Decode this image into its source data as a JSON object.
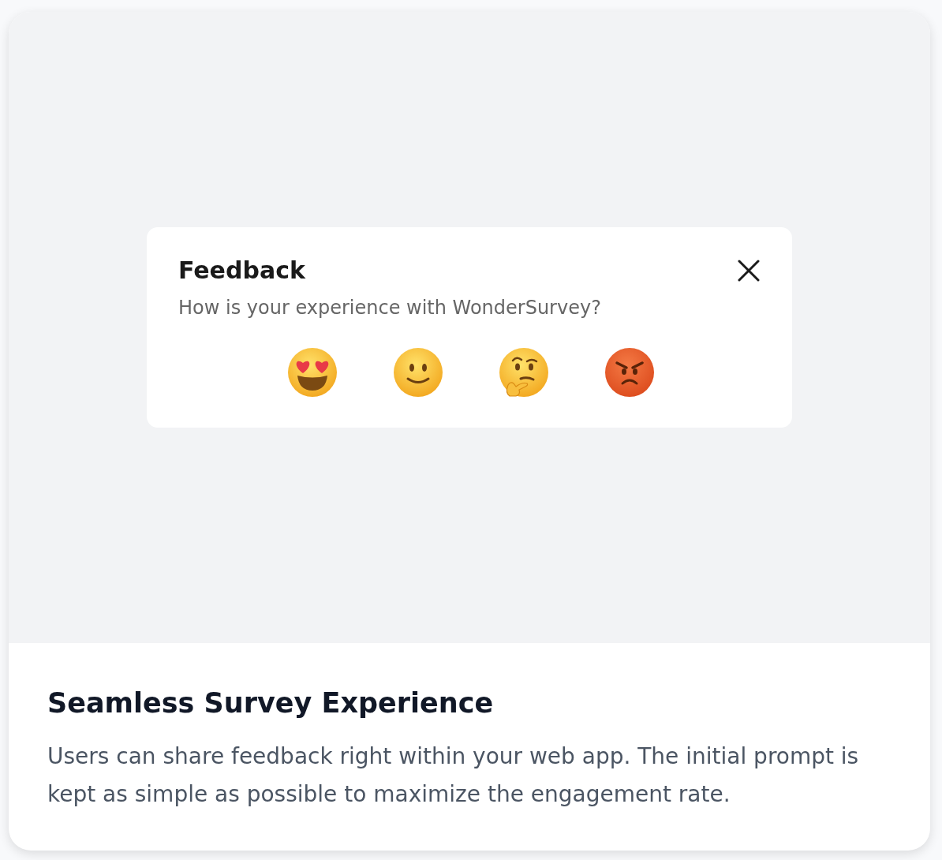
{
  "dialog": {
    "title": "Feedback",
    "question": "How is your experience with WonderSurvey?",
    "ratings": [
      {
        "kind": "heart_eyes"
      },
      {
        "kind": "smile"
      },
      {
        "kind": "thinking"
      },
      {
        "kind": "angry"
      }
    ]
  },
  "feature": {
    "heading": "Seamless Survey Experience",
    "description": "Users can share feedback right within your web app. The initial prompt is kept as simple as possible to maximize the engagement rate."
  }
}
